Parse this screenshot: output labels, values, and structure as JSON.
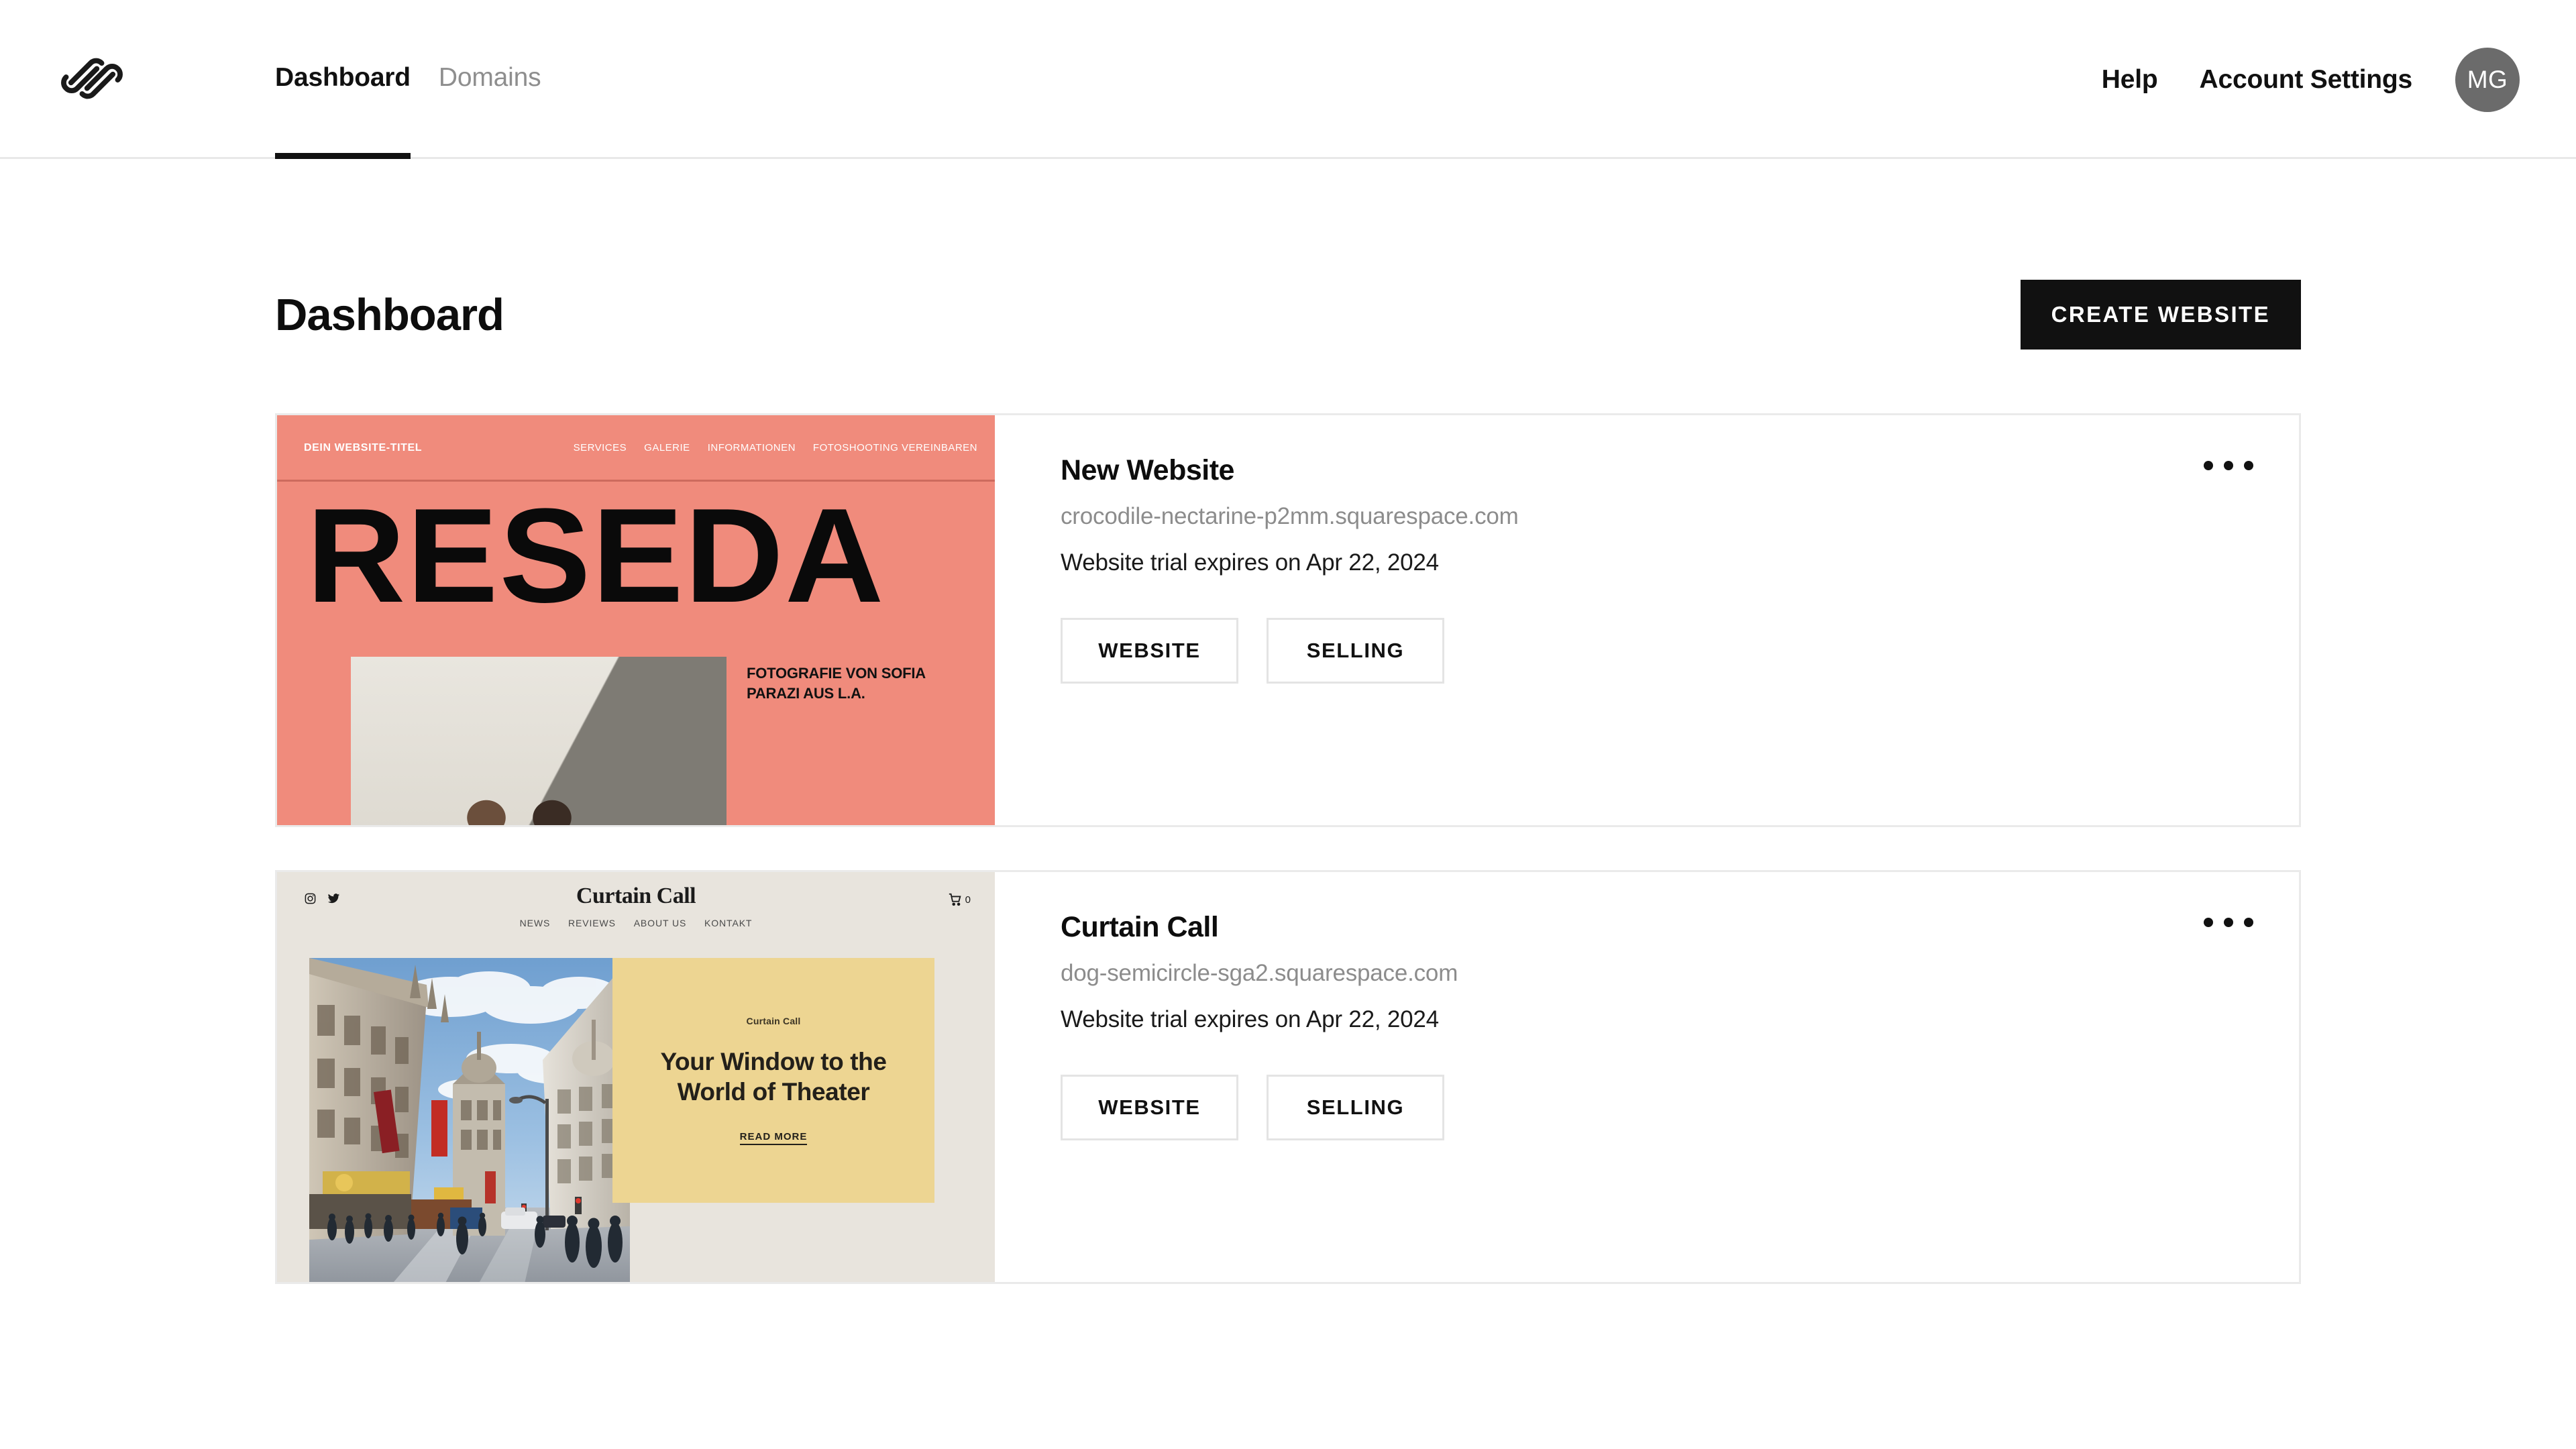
{
  "nav": {
    "logo_icon": "squarespace-logo-icon",
    "tabs": [
      {
        "label": "Dashboard",
        "active": true
      },
      {
        "label": "Domains",
        "active": false
      }
    ],
    "help_label": "Help",
    "account_settings_label": "Account Settings",
    "avatar_initials": "MG"
  },
  "page": {
    "title": "Dashboard",
    "create_button": "CREATE WEBSITE"
  },
  "sites": [
    {
      "name": "New Website",
      "url": "crocodile-nectarine-p2mm.squarespace.com",
      "trial": "Website trial expires on Apr 22, 2024",
      "website_button": "WEBSITE",
      "selling_button": "SELLING",
      "menu_icon": "more-options-icon",
      "preview": {
        "theme": "reseda",
        "site_title": "DEIN WEBSITE-TITEL",
        "nav": [
          "SERVICES",
          "GALERIE",
          "INFORMATIONEN",
          "FOTOSHOOTING VEREINBAREN"
        ],
        "headline": "RESEDA",
        "caption": "FOTOGRAFIE VON SOFIA PARAZI AUS L.A.",
        "bg_color": "#f08b7c"
      }
    },
    {
      "name": "Curtain Call",
      "url": "dog-semicircle-sga2.squarespace.com",
      "trial": "Website trial expires on Apr 22, 2024",
      "website_button": "WEBSITE",
      "selling_button": "SELLING",
      "menu_icon": "more-options-icon",
      "preview": {
        "theme": "curtain-call",
        "brand": "Curtain Call",
        "nav": [
          "NEWS",
          "REVIEWS",
          "ABOUT US",
          "KONTAKT"
        ],
        "cart_count": "0",
        "social_icons": [
          "instagram-icon",
          "twitter-icon"
        ],
        "eyebrow": "Curtain Call",
        "headline": "Your Window to the World of Theater",
        "read_more": "READ MORE",
        "bg_color": "#e8e4dd",
        "panel_color": "#edd592"
      }
    }
  ],
  "colors": {
    "accent_black": "#111111",
    "muted_text": "#8c8c8c",
    "border": "#eaeaea",
    "avatar_bg": "#6b6b6b"
  }
}
